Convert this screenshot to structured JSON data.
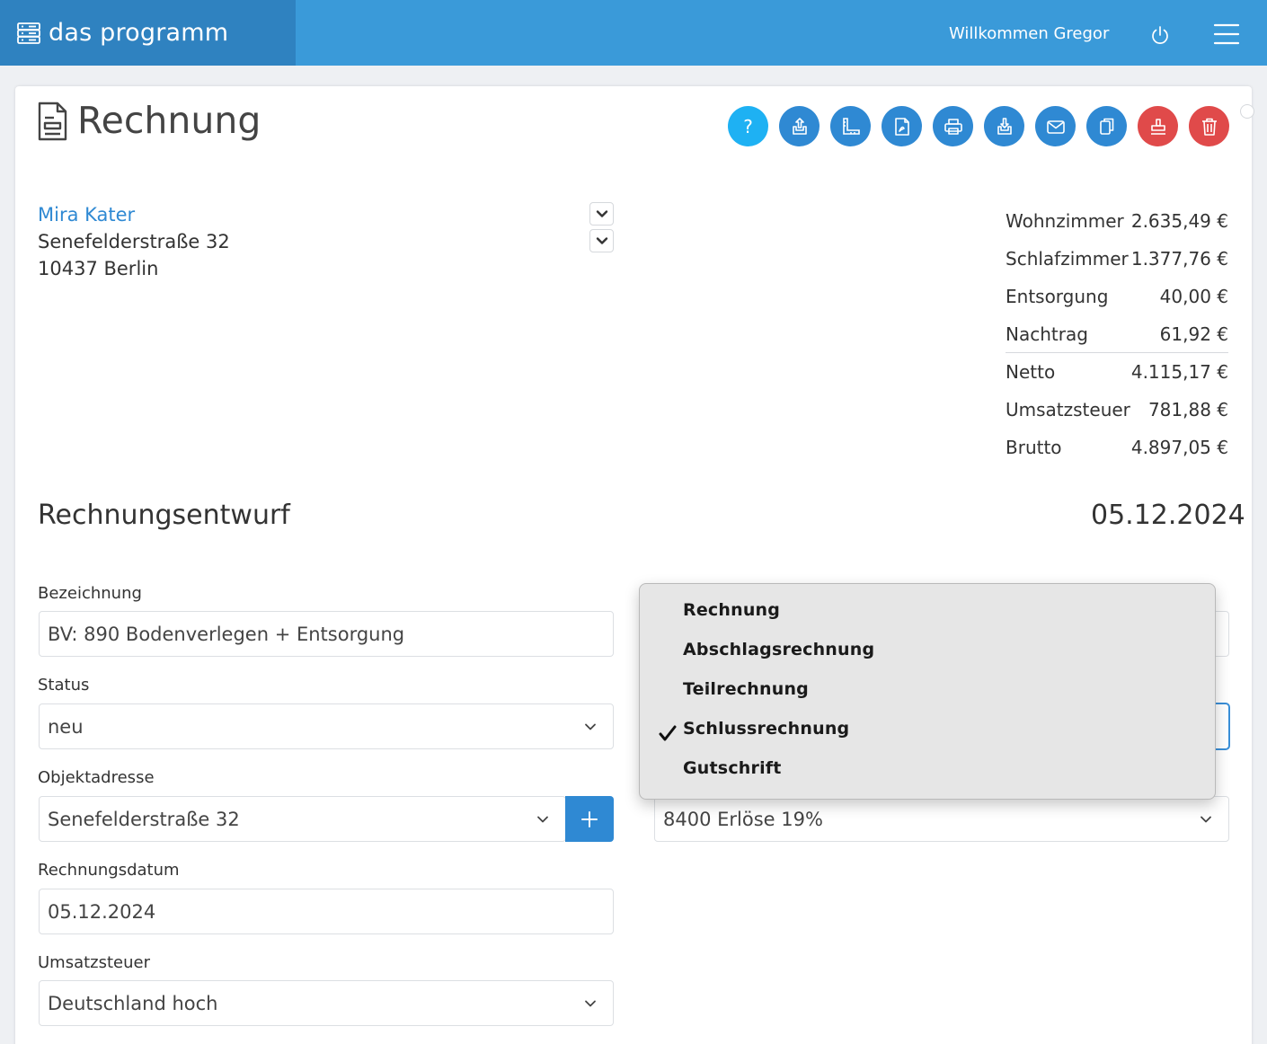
{
  "app": {
    "name": "das programm",
    "welcome": "Willkommen Gregor"
  },
  "page": {
    "title": "Rechnung"
  },
  "toolbar": {
    "help_label": "?"
  },
  "customer": {
    "name": "Mira Kater",
    "street": "Senefelderstraße 32",
    "city": "10437 Berlin"
  },
  "totals": [
    {
      "label": "Wohnzimmer",
      "value": "2.635,49 €"
    },
    {
      "label": "Schlafzimmer",
      "value": "1.377,76 €"
    },
    {
      "label": "Entsorgung",
      "value": "40,00 €"
    },
    {
      "label": "Nachtrag",
      "value": "61,92 €"
    },
    {
      "label": "Netto",
      "value": "4.115,17 €"
    },
    {
      "label": "Umsatzsteuer",
      "value": "781,88 €"
    },
    {
      "label": "Brutto",
      "value": "4.897,05 €"
    }
  ],
  "draft": {
    "title": "Rechnungsentwurf",
    "date": "05.12.2024"
  },
  "form": {
    "bezeichnung": {
      "label": "Bezeichnung",
      "value": "BV: 890 Bodenverlegen + Entsorgung"
    },
    "status": {
      "label": "Status",
      "value": "neu"
    },
    "objektadresse": {
      "label": "Objektadresse",
      "value": "Senefelderstraße 32"
    },
    "rechnungsdatum": {
      "label": "Rechnungsdatum",
      "value": "05.12.2024"
    },
    "umsatzsteuer": {
      "label": "Umsatzsteuer",
      "value": "Deutschland hoch"
    },
    "konto": {
      "value": "8400 Erlöse 19%"
    }
  },
  "type_dropdown": {
    "options": [
      "Rechnung",
      "Abschlagsrechnung",
      "Teilrechnung",
      "Schlussrechnung",
      "Gutschrift"
    ],
    "selected": "Schlussrechnung"
  }
}
